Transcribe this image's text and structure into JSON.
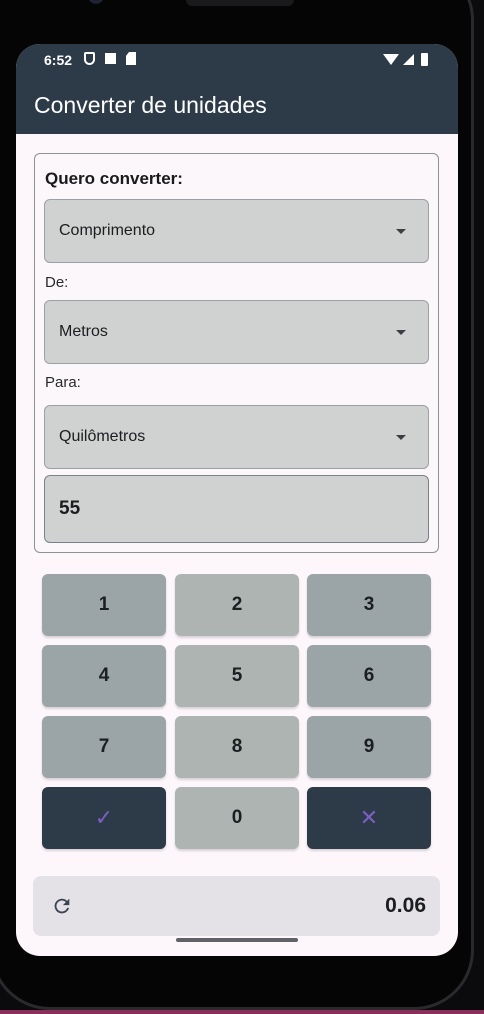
{
  "status": {
    "time": "6:52",
    "left_icons": [
      "shield-icon",
      "a-icon",
      "sd-card-icon"
    ],
    "right_icons": [
      "wifi-icon",
      "signal-icon",
      "battery-icon"
    ]
  },
  "appbar": {
    "title": "Converter de unidades"
  },
  "form": {
    "heading": "Quero converter:",
    "category": {
      "value": "Comprimento"
    },
    "from_label": "De:",
    "from": {
      "value": "Metros"
    },
    "to_label": "Para:",
    "to": {
      "value": "Quilômetros"
    },
    "input_value": "55"
  },
  "keypad": {
    "keys": [
      "1",
      "2",
      "3",
      "4",
      "5",
      "6",
      "7",
      "8",
      "9",
      "✓",
      "0",
      "✕"
    ],
    "confirm_icon": "check-icon",
    "clear_icon": "close-icon"
  },
  "result": {
    "value": "0.06",
    "refresh_icon": "refresh-icon"
  },
  "colors": {
    "appbar": "#2d3a48",
    "field": "#cfd2d1",
    "key": "#9ba5a8",
    "accent_icon": "#7b5fc2"
  }
}
